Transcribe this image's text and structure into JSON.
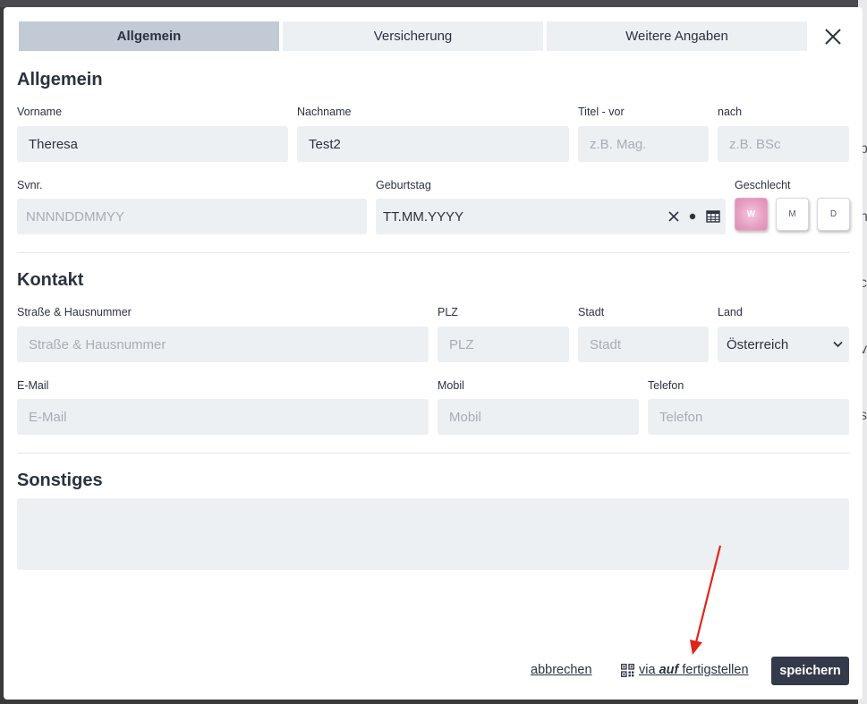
{
  "tabs": [
    {
      "label": "Allgemein",
      "active": true
    },
    {
      "label": "Versicherung",
      "active": false
    },
    {
      "label": "Weitere Angaben",
      "active": false
    }
  ],
  "sections": {
    "general": "Allgemein",
    "contact": "Kontakt",
    "other": "Sonstiges"
  },
  "general": {
    "first_name": {
      "label": "Vorname",
      "value": "Theresa"
    },
    "last_name": {
      "label": "Nachname",
      "value": "Test2"
    },
    "title_pre": {
      "label": "Titel - vor",
      "placeholder": "z.B. Mag."
    },
    "title_post": {
      "label": "nach",
      "placeholder": "z.B. BSc"
    },
    "svnr": {
      "label": "Svnr.",
      "placeholder": "NNNNDDMMYY"
    },
    "birthday": {
      "label": "Geburtstag",
      "value": "TT.MM.YYYY"
    },
    "gender": {
      "label": "Geschlecht",
      "options": [
        {
          "label": "W",
          "active": true
        },
        {
          "label": "M",
          "active": false
        },
        {
          "label": "D",
          "active": false
        }
      ]
    }
  },
  "contact": {
    "street": {
      "label": "Straße & Hausnummer",
      "placeholder": "Straße & Hausnummer"
    },
    "zip": {
      "label": "PLZ",
      "placeholder": "PLZ"
    },
    "city": {
      "label": "Stadt",
      "placeholder": "Stadt"
    },
    "country": {
      "label": "Land",
      "value": "Österreich"
    },
    "email": {
      "label": "E-Mail",
      "placeholder": "E-Mail"
    },
    "mobile": {
      "label": "Mobil",
      "placeholder": "Mobil"
    },
    "phone": {
      "label": "Telefon",
      "placeholder": "Telefon"
    }
  },
  "footer": {
    "cancel": "abbrechen",
    "via_pre": "via",
    "via_em": "auf",
    "via_post": "fertigstellen",
    "save": "speichern"
  },
  "colors": {
    "accent_dark": "#343a4a",
    "tab_active": "#c1cad5",
    "input_bg": "#edf0f3",
    "gender_active": "#e7a2c3",
    "annotation_arrow": "#e0241b"
  },
  "backdrop_letters": [
    "b",
    "n",
    "c",
    "v",
    "s"
  ]
}
